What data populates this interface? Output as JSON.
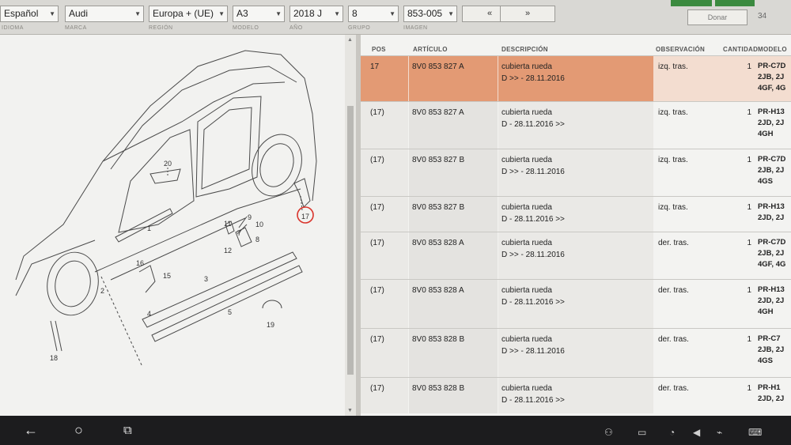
{
  "filters": [
    {
      "key": "idioma",
      "value": "Español",
      "label": "IDIOMA"
    },
    {
      "key": "marca",
      "value": "Audi",
      "label": "MARCA"
    },
    {
      "key": "region",
      "value": "Europa + (UE)",
      "label": "REGIÓN"
    },
    {
      "key": "modelo",
      "value": "A3",
      "label": "MODELO"
    },
    {
      "key": "anio",
      "value": "2018 J",
      "label": "AÑO"
    },
    {
      "key": "grupo",
      "value": "8",
      "label": "GRUPO"
    },
    {
      "key": "imagen",
      "value": "853-005",
      "label": "IMAGEN"
    }
  ],
  "nav": {
    "prev": "«",
    "next": "»"
  },
  "donate_label": "Donar",
  "page_count": "34",
  "table": {
    "headers": {
      "pos": "POS",
      "articulo": "ARTÍCULO",
      "descripcion": "DESCRIPCIÓN",
      "observacion": "OBSERVACIÓN",
      "cantidad": "CANTIDAD",
      "modelo": "MODELO"
    },
    "rows": [
      {
        "pos": "17",
        "articulo": "8V0 853 827 A",
        "desc1": "cubierta rueda",
        "desc2": "D >> - 28.11.2016",
        "obs": "izq. tras.",
        "cant": "1",
        "mod1": "PR-C7D",
        "mod2": "2JB, 2J",
        "mod3": "4GF, 4G",
        "selected": true
      },
      {
        "pos": "(17)",
        "articulo": "8V0 853 827 A",
        "desc1": "cubierta rueda",
        "desc2": "D - 28.11.2016 >>",
        "obs": "izq. tras.",
        "cant": "1",
        "mod1": "PR-H13",
        "mod2": "2JD, 2J",
        "mod3": "4GH",
        "selected": false
      },
      {
        "pos": "(17)",
        "articulo": "8V0 853 827 B",
        "desc1": "cubierta rueda",
        "desc2": "D >> - 28.11.2016",
        "obs": "izq. tras.",
        "cant": "1",
        "mod1": "PR-C7D",
        "mod2": "2JB, 2J",
        "mod3": "4GS",
        "selected": false
      },
      {
        "pos": "(17)",
        "articulo": "8V0 853 827 B",
        "desc1": "cubierta rueda",
        "desc2": "D - 28.11.2016 >>",
        "obs": "izq. tras.",
        "cant": "1",
        "mod1": "PR-H13",
        "mod2": "2JD, 2J",
        "mod3": "",
        "selected": false
      },
      {
        "pos": "(17)",
        "articulo": "8V0 853 828 A",
        "desc1": "cubierta rueda",
        "desc2": "D >> - 28.11.2016",
        "obs": "der. tras.",
        "cant": "1",
        "mod1": "PR-C7D",
        "mod2": "2JB, 2J",
        "mod3": "4GF, 4G",
        "selected": false
      },
      {
        "pos": "(17)",
        "articulo": "8V0 853 828 A",
        "desc1": "cubierta rueda",
        "desc2": "D - 28.11.2016 >>",
        "obs": "der. tras.",
        "cant": "1",
        "mod1": "PR-H13",
        "mod2": "2JD, 2J",
        "mod3": "4GH",
        "selected": false
      },
      {
        "pos": "(17)",
        "articulo": "8V0 853 828 B",
        "desc1": "cubierta rueda",
        "desc2": "D >> - 28.11.2016",
        "obs": "der. tras.",
        "cant": "1",
        "mod1": "PR-C7",
        "mod2": "2JB, 2J",
        "mod3": "4GS",
        "selected": false
      },
      {
        "pos": "(17)",
        "articulo": "8V0 853 828 B",
        "desc1": "cubierta rueda",
        "desc2": "D - 28.11.2016 >>",
        "obs": "der. tras.",
        "cant": "1",
        "mod1": "PR-H1",
        "mod2": "2JD, 2J",
        "mod3": "",
        "selected": false
      }
    ]
  },
  "diagram": {
    "callouts": [
      "1",
      "2",
      "3",
      "4",
      "5",
      "7",
      "8",
      "9",
      "10",
      "11",
      "12",
      "15",
      "16",
      "17",
      "18",
      "19",
      "20"
    ],
    "highlighted_callout": "17"
  },
  "colors": {
    "selected_row": "#e39a74",
    "highlight_ring": "#d9342b",
    "topbar_accent": "#3b8a3f"
  },
  "system_nav_icons": [
    "back-icon",
    "home-icon",
    "recents-icon"
  ]
}
